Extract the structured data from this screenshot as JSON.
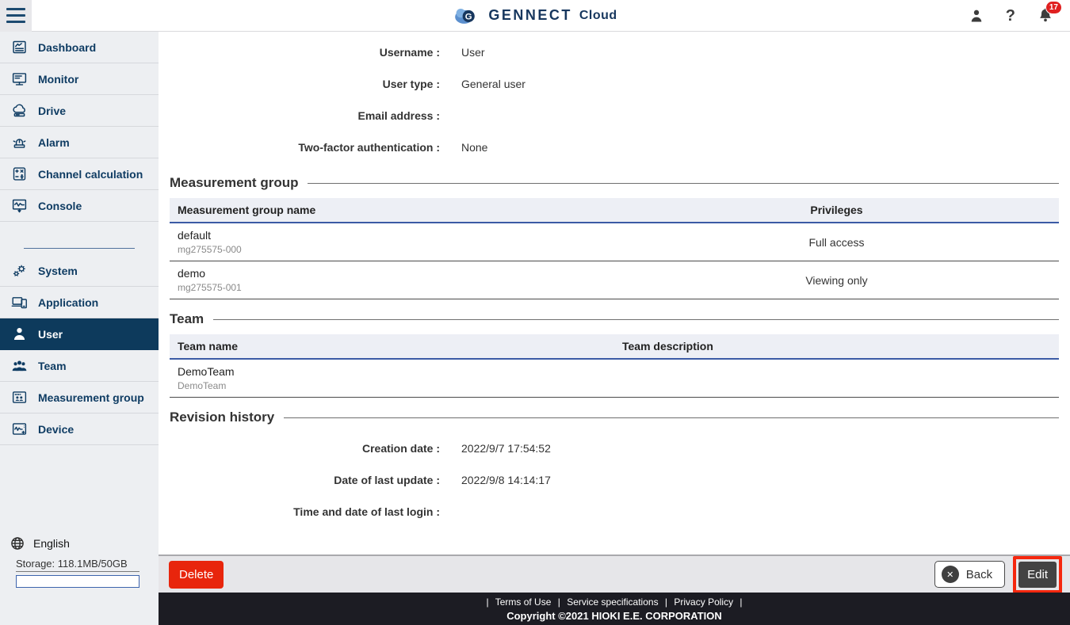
{
  "header": {
    "logo_text": "GENNECT",
    "logo_suffix": "Cloud",
    "help_label": "?",
    "notification_count": "17"
  },
  "sidebar": {
    "items_top": [
      {
        "label": "Dashboard"
      },
      {
        "label": "Monitor"
      },
      {
        "label": "Drive"
      },
      {
        "label": "Alarm"
      },
      {
        "label": "Channel calculation"
      },
      {
        "label": "Console"
      }
    ],
    "items_bottom": [
      {
        "label": "System"
      },
      {
        "label": "Application"
      },
      {
        "label": "User",
        "selected": true
      },
      {
        "label": "Team"
      },
      {
        "label": "Measurement group"
      },
      {
        "label": "Device"
      }
    ],
    "language": "English",
    "storage": "Storage: 118.1MB/50GB"
  },
  "user_info": {
    "fields": [
      {
        "label": "Username :",
        "value": "User"
      },
      {
        "label": "User type :",
        "value": "General user"
      },
      {
        "label": "Email address :",
        "value": ""
      },
      {
        "label": "Two-factor authentication :",
        "value": "None"
      }
    ]
  },
  "measurement_group": {
    "title": "Measurement group",
    "columns": [
      "Measurement group name",
      "Privileges"
    ],
    "rows": [
      {
        "name": "default",
        "code": "mg275575-000",
        "privilege": "Full access"
      },
      {
        "name": "demo",
        "code": "mg275575-001",
        "privilege": "Viewing only"
      }
    ]
  },
  "team": {
    "title": "Team",
    "columns": [
      "Team name",
      "Team description"
    ],
    "rows": [
      {
        "name": "DemoTeam",
        "code": "DemoTeam",
        "description": ""
      }
    ]
  },
  "revision_history": {
    "title": "Revision history",
    "fields": [
      {
        "label": "Creation date :",
        "value": "2022/9/7 17:54:52"
      },
      {
        "label": "Date of last update :",
        "value": "2022/9/8 14:14:17"
      },
      {
        "label": "Time and date of last login :",
        "value": ""
      }
    ]
  },
  "actions": {
    "delete_label": "Delete",
    "back_label": "Back",
    "edit_label": "Edit"
  },
  "footer": {
    "separator": "|",
    "links": [
      "Terms of Use",
      "Service specifications",
      "Privacy Policy"
    ],
    "copyright": "Copyright ©2021 HIOKI E.E. CORPORATION"
  },
  "colors": {
    "navy": "#0d3a5c",
    "table_header_blue": "#3b5ba5",
    "delete_red": "#e8250c",
    "annotation_red": "#f5270e",
    "badge_red": "#e02020"
  }
}
